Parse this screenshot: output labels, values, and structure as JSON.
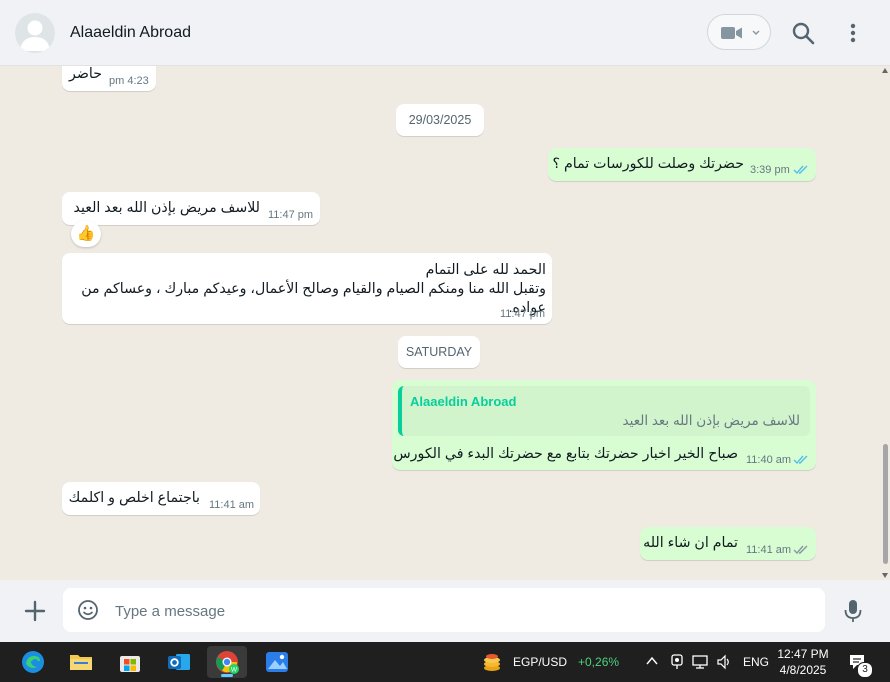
{
  "header": {
    "contact_name": "Alaaeldin Abroad"
  },
  "messages": [
    {
      "direction": "in",
      "text": "حاضر",
      "time": "4:23 pm"
    },
    {
      "type": "date",
      "label": "29/03/2025"
    },
    {
      "direction": "out",
      "text": "حضرتك وصلت للكورسات تمام ؟",
      "time": "3:39 pm",
      "status": "read"
    },
    {
      "direction": "in",
      "text": "للاسف مريض بإذن الله بعد العيد",
      "time": "11:47 pm",
      "reaction": "👍"
    },
    {
      "direction": "in",
      "lines": [
        "الحمد لله على التمام",
        "وتقبل الله منا ومنكم الصيام والقيام وصالح الأعمال، وعيدكم مبارك ، وعساكم من",
        "عواده."
      ],
      "time": "11:47 pm"
    },
    {
      "type": "date",
      "label": "SATURDAY"
    },
    {
      "direction": "out",
      "quote_author": "Alaaeldin Abroad",
      "quote_text": "للاسف مريض بإذن الله بعد العيد",
      "text": "صباح الخير اخبار حضرتك بتابع مع حضرتك البدء في الكورس",
      "time": "11:40 am",
      "status": "read"
    },
    {
      "direction": "in",
      "text": "باجتماع اخلص و اكلمك",
      "time": "11:41 am"
    },
    {
      "direction": "out",
      "text": "تمام ان شاء الله",
      "time": "11:41 am",
      "status": "read"
    }
  ],
  "composer": {
    "placeholder": "Type a message"
  },
  "taskbar": {
    "ticker_label": "EGP/USD",
    "ticker_change": "+0,26%",
    "language": "ENG",
    "time": "12:47 PM",
    "date": "4/8/2025",
    "notification_count": "3"
  },
  "colors": {
    "outgoing_bubble": "#d9fdd3",
    "incoming_bubble": "#ffffff",
    "read_ticks": "#53bdeb",
    "quote_accent": "#06cf9c",
    "chat_background": "#efeae2",
    "ticker_positive": "#4fd27e"
  },
  "icons": [
    "default-avatar-icon",
    "video-camera-icon",
    "chevron-down-icon",
    "search-icon",
    "more-vertical-icon",
    "double-check-icon",
    "plus-icon",
    "emoji-icon",
    "microphone-icon"
  ]
}
